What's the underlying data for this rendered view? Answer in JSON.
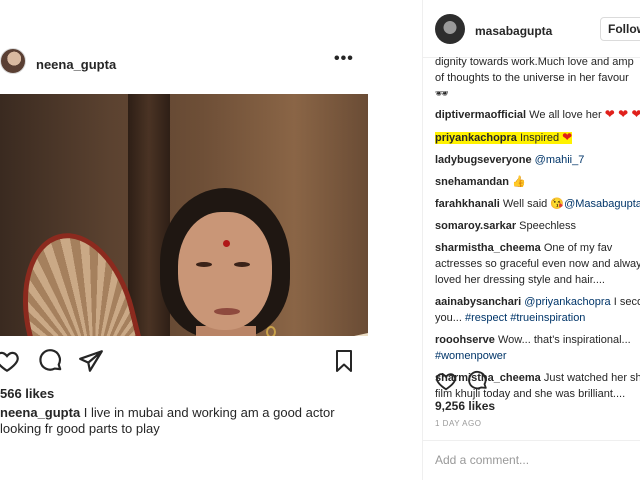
{
  "left_post": {
    "username": "neena_gupta",
    "more_label": "•••",
    "likes": "566 likes",
    "caption_user": "neena_gupta",
    "caption_text": " I live in mubai and working am a good actor looking fr good parts to play"
  },
  "right_post": {
    "username": "masabagupta",
    "follow_label": "Follow",
    "intro_line1": "dignity towards work.Much love and amp",
    "intro_line2": "of thoughts to the universe in her favour",
    "comments": [
      {
        "user": "diptivermaofficial",
        "text": " We all love her ",
        "emoji": "❤ ❤ ❤"
      },
      {
        "user": "priyankachopra",
        "text": " Inspired ",
        "emoji": "❤"
      },
      {
        "user": "ladybugseveryone",
        "text": " ",
        "mention": "@mahii_7"
      },
      {
        "user": "snehamandan",
        "text": " ",
        "emoji": "👍"
      },
      {
        "user": "farahkhanali",
        "text": " Well said ",
        "emoji": "😘",
        "mention": "@Masabagupta"
      },
      {
        "user": "somaroy.sarkar",
        "text": " Speechless"
      },
      {
        "user": "sharmistha_cheema",
        "text": " One of my fav",
        "line2": "actresses so graceful even now and alway",
        "line3": "loved her dressing style and hair...."
      },
      {
        "user": "aainabysanchari",
        "mention": "@priyankachopra",
        "text": " I secor",
        "line2": "you...",
        "tags": "#respect #trueinspiration"
      },
      {
        "user": "rooohserve",
        "text": " Wow... that's inspirational...",
        "tags": "#womenpower"
      },
      {
        "user": "sharmistha_cheema",
        "text": " Just watched her sho",
        "line2": "film khujli today and she was brilliant...."
      }
    ],
    "likes": "9,256 likes",
    "time": "1 DAY AGO",
    "add_comment_placeholder": "Add a comment..."
  }
}
